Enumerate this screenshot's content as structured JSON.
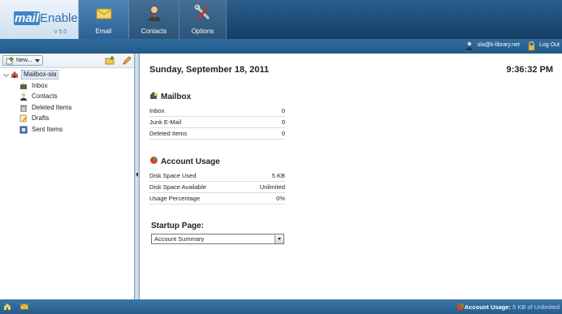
{
  "header": {
    "logo_mail": "mail",
    "logo_enable": "Enable",
    "version": "v 5.0",
    "tabs": [
      {
        "label": "Email",
        "icon": "envelope-icon"
      },
      {
        "label": "Contacts",
        "icon": "person-icon"
      },
      {
        "label": "Options",
        "icon": "tools-icon"
      }
    ]
  },
  "userbar": {
    "email": "sla@k-library.net",
    "logout": "Log Out"
  },
  "sidebar": {
    "new_label": "New...",
    "root": "Mailbox-sla",
    "folders": [
      {
        "label": "Inbox",
        "icon": "inbox-icon"
      },
      {
        "label": "Contacts",
        "icon": "contacts-icon"
      },
      {
        "label": "Deleted Items",
        "icon": "trash-icon"
      },
      {
        "label": "Drafts",
        "icon": "drafts-icon"
      },
      {
        "label": "Sent Items",
        "icon": "sent-icon"
      }
    ]
  },
  "main": {
    "date": "Sunday, September 18, 2011",
    "time": "9:36:32 PM",
    "mailbox": {
      "title": "Mailbox",
      "rows": [
        {
          "key": "Inbox",
          "value": "0"
        },
        {
          "key": "Junk E-Mail",
          "value": "0"
        },
        {
          "key": "Deleted Items",
          "value": "0"
        }
      ]
    },
    "usage": {
      "title": "Account Usage",
      "rows": [
        {
          "key": "Disk Space Used",
          "value": "5 KB"
        },
        {
          "key": "Disk Space Available",
          "value": "Unlimited"
        },
        {
          "key": "Usage Percentage",
          "value": "0%"
        }
      ]
    },
    "startup": {
      "label": "Startup Page:",
      "selected": "Account Summary"
    }
  },
  "footer": {
    "usage_label": "Account Usage:",
    "usage_value": "5 KB of Unlimited"
  },
  "colors": {
    "header_dark": "#1d4a74",
    "accent": "#2f6fa9",
    "panel_border": "#8aa6c1"
  }
}
